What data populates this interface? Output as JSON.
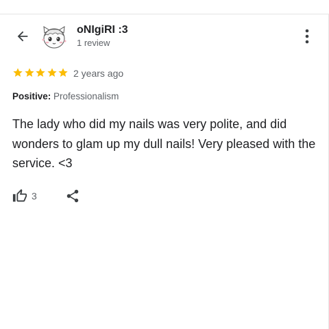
{
  "reviewer": {
    "name": "oNIgiRI :3",
    "review_count": "1 review"
  },
  "review": {
    "rating": 5,
    "rating_max": 5,
    "time_ago": "2 years ago",
    "positive_label": "Positive:",
    "positive_value": "Professionalism",
    "text": "The lady who did my nails was very polite, and did wonders to glam up my dull nails! Very pleased with the service. <3",
    "likes": "3"
  },
  "icons": {
    "back": "arrow-back-icon",
    "avatar": "anime-avatar",
    "more": "more-vert-icon",
    "star": "star-icon",
    "like": "thumb-up-icon",
    "share": "share-icon"
  },
  "colors": {
    "star": "#fbbc04",
    "text_primary": "#202124",
    "text_secondary": "#5f6368",
    "icon": "#3c4043"
  }
}
